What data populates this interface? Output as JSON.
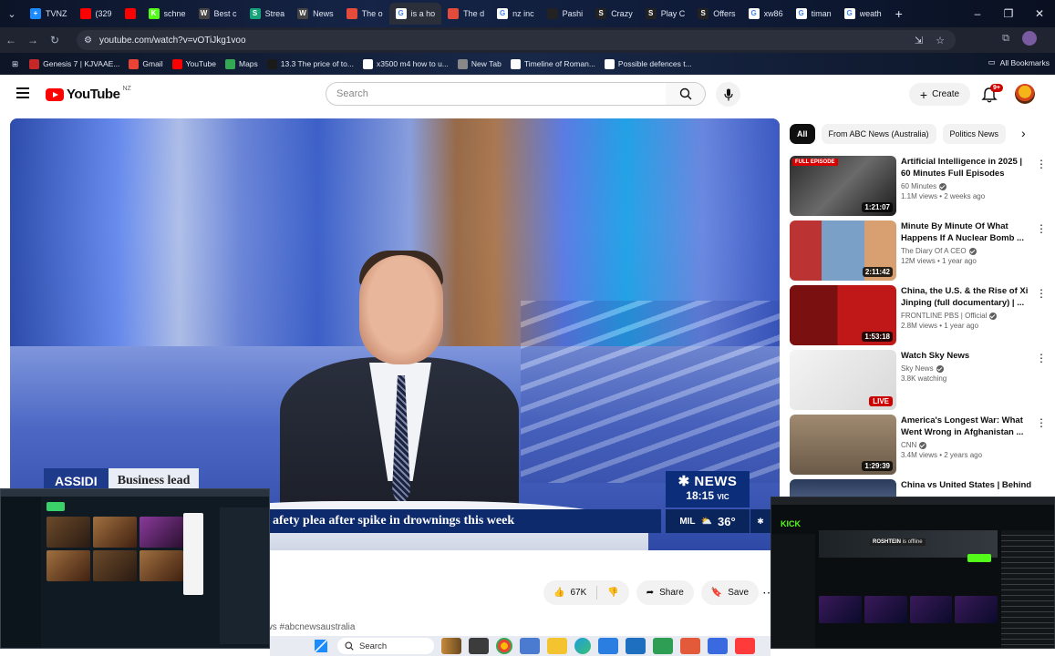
{
  "browser": {
    "tabs": [
      {
        "label": "TVNZ",
        "color": "#1a8cff",
        "glyph": "+"
      },
      {
        "label": "(329",
        "color": "#ff0000",
        "glyph": ""
      },
      {
        "label": "",
        "color": "#ff0000",
        "glyph": ""
      },
      {
        "label": "schne",
        "color": "#53fc18",
        "glyph": "K"
      },
      {
        "label": "Best c",
        "color": "#444444",
        "glyph": "W"
      },
      {
        "label": "Strea",
        "color": "#16a37a",
        "glyph": "S"
      },
      {
        "label": "News",
        "color": "#444444",
        "glyph": "W"
      },
      {
        "label": "The o",
        "color": "#e44b3a",
        "glyph": ""
      },
      {
        "label": "is a ho",
        "color": "#ffffff",
        "glyph": "G"
      },
      {
        "label": "The d",
        "color": "#e44b3a",
        "glyph": ""
      },
      {
        "label": "nz inc",
        "color": "#ffffff",
        "glyph": "G"
      },
      {
        "label": "Pashi",
        "color": "#222222",
        "glyph": ""
      },
      {
        "label": "Crazy",
        "color": "#222222",
        "glyph": "S"
      },
      {
        "label": "Play C",
        "color": "#222222",
        "glyph": "S"
      },
      {
        "label": "Offers",
        "color": "#222222",
        "glyph": "S"
      },
      {
        "label": "xw86",
        "color": "#ffffff",
        "glyph": "G"
      },
      {
        "label": "timan",
        "color": "#ffffff",
        "glyph": "G"
      },
      {
        "label": "weath",
        "color": "#ffffff",
        "glyph": "G"
      }
    ],
    "url": "youtube.com/watch?v=vOTiJkg1voo",
    "bookmarks": [
      {
        "label": "Genesis 7 | KJVAAE...",
        "color": "#c62828"
      },
      {
        "label": "Gmail",
        "color": "#ea4335"
      },
      {
        "label": "YouTube",
        "color": "#ff0000"
      },
      {
        "label": "Maps",
        "color": "#34a853"
      },
      {
        "label": "13.3 The price of to...",
        "color": "#1a1a1a"
      },
      {
        "label": "x3500 m4 how to u...",
        "color": "#ffffff"
      },
      {
        "label": "New Tab",
        "color": "#888888"
      },
      {
        "label": "Timeline of Roman...",
        "color": "#ffffff"
      },
      {
        "label": "Possible defences t...",
        "color": "#ffffff"
      }
    ],
    "all_bookmarks": "All Bookmarks"
  },
  "youtube": {
    "logo": "YouTube",
    "country": "NZ",
    "search_placeholder": "Search",
    "create": "Create",
    "notifications": "9+"
  },
  "video": {
    "lower_third_name": "ASSIDI",
    "lower_third_sub": "Business lead",
    "ticker": "afety plea after spike in drownings this week",
    "channel_brand": "NEWS",
    "time": "18:15",
    "timezone": "VIC",
    "weather_city": "MIL",
    "temperature": "36°"
  },
  "actions": {
    "likes": "67K",
    "share": "Share",
    "save": "Save"
  },
  "description_tag": "ews #abcnewsaustralia",
  "chips": [
    "All",
    "From ABC News (Australia)",
    "Politics News"
  ],
  "recommendations": [
    {
      "title": "Artificial Intelligence in 2025 | 60 Minutes Full Episodes",
      "channel": "60 Minutes",
      "meta": "1.1M views • 2 weeks ago",
      "duration": "1:21:07",
      "thumb_badge": "FULL EPISODE",
      "verified": true
    },
    {
      "title": "Minute By Minute Of What Happens If A Nuclear Bomb ...",
      "channel": "The Diary Of A CEO",
      "meta": "12M views • 1 year ago",
      "duration": "2:11:42",
      "thumb_badge": "",
      "verified": true
    },
    {
      "title": "China, the U.S. & the Rise of Xi Jinping (full documentary) | ...",
      "channel": "FRONTLINE PBS | Official",
      "meta": "2.8M views • 1 year ago",
      "duration": "1:53:18",
      "thumb_badge": "",
      "verified": true
    },
    {
      "title": "Watch Sky News",
      "channel": "Sky News",
      "meta": "3.8K watching",
      "duration": "LIVE",
      "thumb_badge": "",
      "verified": true
    },
    {
      "title": "America's Longest War: What Went Wrong in Afghanistan ...",
      "channel": "CNN",
      "meta": "3.4M views • 2 years ago",
      "duration": "1:29:39",
      "thumb_badge": "",
      "verified": true
    },
    {
      "title": "China vs United States | Behind",
      "channel": "",
      "meta": "",
      "duration": "",
      "thumb_badge": "",
      "verified": false
    }
  ],
  "overlay_right": {
    "brand": "KICK",
    "offline_user": "ROSHTEIN",
    "offline_text": "is offline"
  },
  "taskbar": {
    "search": "Search"
  }
}
